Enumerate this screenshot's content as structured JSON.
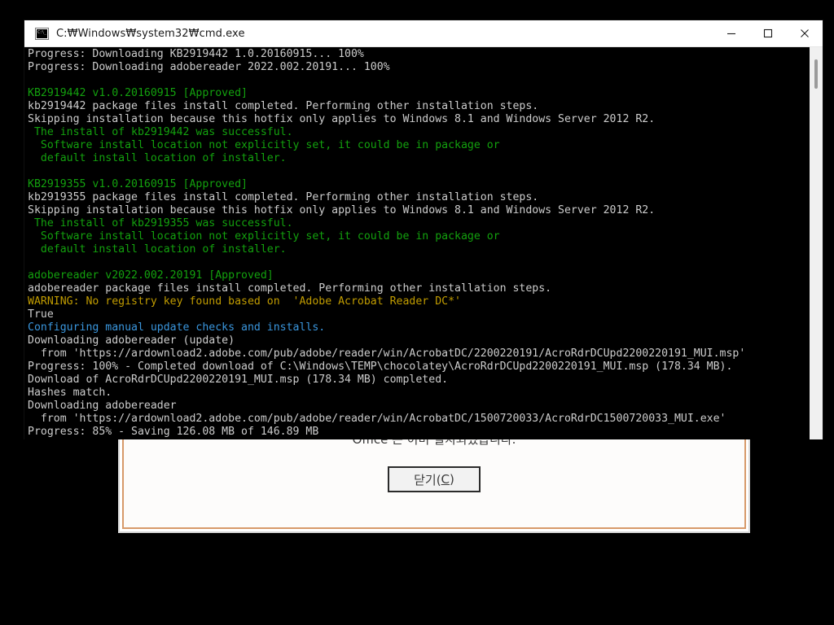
{
  "desktop": {
    "background": "#000000"
  },
  "dialog": {
    "message": "Office 는 이미 설치되었습니다.",
    "close_label_main": "닫기(",
    "close_label_mnemonic": "C",
    "close_label_tail": ")",
    "border_color": "#d79a6a"
  },
  "window": {
    "title": "C:\\Windows\\system32\\cmd.exe",
    "title_display": "C:₩Windows₩system32₩cmd.exe",
    "icon": "cmd-icon",
    "controls": {
      "minimize": "minimize-icon",
      "maximize": "maximize-icon",
      "close": "close-icon"
    }
  },
  "terminal": {
    "background": "#000000",
    "foreground": "#cccccc",
    "green": "#13a10e",
    "yellow": "#c19c00",
    "cyan": "#3a96dd",
    "scroll_thumb_color": "#9b9b9b",
    "lines": [
      {
        "text": "Progress: Downloading KB2919442 1.0.20160915... 100%",
        "color": "fg"
      },
      {
        "text": "Progress: Downloading adobereader 2022.002.20191... 100%",
        "color": "fg"
      },
      {
        "text": "",
        "color": "fg"
      },
      {
        "text": "KB2919442 v1.0.20160915 [Approved]",
        "color": "green"
      },
      {
        "text": "kb2919442 package files install completed. Performing other installation steps.",
        "color": "fg"
      },
      {
        "text": "Skipping installation because this hotfix only applies to Windows 8.1 and Windows Server 2012 R2.",
        "color": "fg"
      },
      {
        "text": " The install of kb2919442 was successful.",
        "color": "green"
      },
      {
        "text": "  Software install location not explicitly set, it could be in package or",
        "color": "green"
      },
      {
        "text": "  default install location of installer.",
        "color": "green"
      },
      {
        "text": "",
        "color": "fg"
      },
      {
        "text": "KB2919355 v1.0.20160915 [Approved]",
        "color": "green"
      },
      {
        "text": "kb2919355 package files install completed. Performing other installation steps.",
        "color": "fg"
      },
      {
        "text": "Skipping installation because this hotfix only applies to Windows 8.1 and Windows Server 2012 R2.",
        "color": "fg"
      },
      {
        "text": " The install of kb2919355 was successful.",
        "color": "green"
      },
      {
        "text": "  Software install location not explicitly set, it could be in package or",
        "color": "green"
      },
      {
        "text": "  default install location of installer.",
        "color": "green"
      },
      {
        "text": "",
        "color": "fg"
      },
      {
        "text": "adobereader v2022.002.20191 [Approved]",
        "color": "green"
      },
      {
        "text": "adobereader package files install completed. Performing other installation steps.",
        "color": "fg"
      },
      {
        "text": "WARNING: No registry key found based on  'Adobe Acrobat Reader DC*'",
        "color": "yellow"
      },
      {
        "text": "True",
        "color": "fg"
      },
      {
        "text": "Configuring manual update checks and installs.",
        "color": "cyan"
      },
      {
        "text": "Downloading adobereader (update)",
        "color": "fg"
      },
      {
        "text": "  from 'https://ardownload2.adobe.com/pub/adobe/reader/win/AcrobatDC/2200220191/AcroRdrDCUpd2200220191_MUI.msp'",
        "color": "fg"
      },
      {
        "text": "Progress: 100% - Completed download of C:\\Windows\\TEMP\\chocolatey\\AcroRdrDCUpd2200220191_MUI.msp (178.34 MB).",
        "color": "fg"
      },
      {
        "text": "Download of AcroRdrDCUpd2200220191_MUI.msp (178.34 MB) completed.",
        "color": "fg"
      },
      {
        "text": "Hashes match.",
        "color": "fg"
      },
      {
        "text": "Downloading adobereader",
        "color": "fg"
      },
      {
        "text": "  from 'https://ardownload2.adobe.com/pub/adobe/reader/win/AcrobatDC/1500720033/AcroRdrDC1500720033_MUI.exe'",
        "color": "fg"
      },
      {
        "text": "Progress: 85% - Saving 126.08 MB of 146.89 MB",
        "color": "fg"
      }
    ]
  }
}
